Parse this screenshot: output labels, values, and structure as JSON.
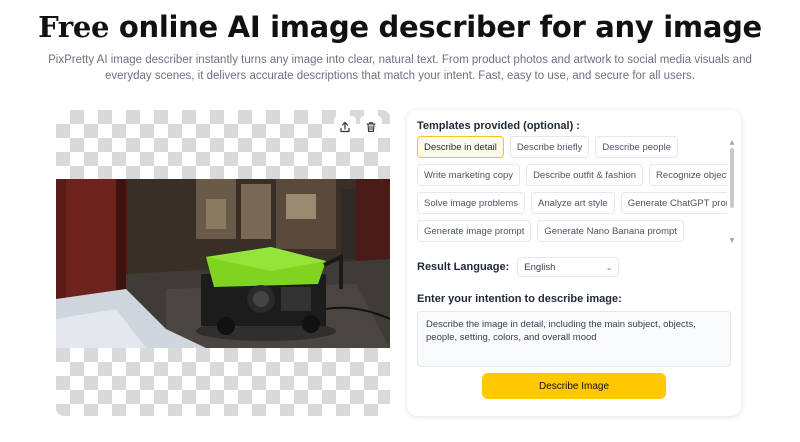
{
  "hero": {
    "title_highlight": "Free",
    "title_rest": " online AI image describer for any image",
    "description": "PixPretty AI image describer instantly turns any image into clear, natural text. From product photos and artwork to social media visuals and everyday scenes, it delivers accurate descriptions that match your intent. Fast, easy to use, and secure for all users."
  },
  "image_card": {
    "upload_icon": "upload-icon",
    "delete_icon": "trash-icon"
  },
  "panel": {
    "templates_label": "Templates provided (optional) :",
    "templates": [
      [
        "Describe in detail",
        "Describe briefly",
        "Describe people"
      ],
      [
        "Write marketing copy",
        "Describe outfit & fashion",
        "Recognize objects"
      ],
      [
        "Solve image problems",
        "Analyze art style",
        "Generate ChatGPT prompt"
      ],
      [
        "Generate image prompt",
        "Generate Nano Banana prompt"
      ]
    ],
    "active_template": "Describe in detail",
    "language_label": "Result Language:",
    "language_value": "English",
    "intention_label": "Enter your intention to describe image:",
    "intention_value": "Describe the image in detail, including the main subject, objects, people, setting, colors, and overall mood",
    "describe_button": "Describe Image"
  },
  "colors": {
    "accent": "#ffc800",
    "highlight": "#ffe229",
    "generator_green": "#7fd321"
  }
}
